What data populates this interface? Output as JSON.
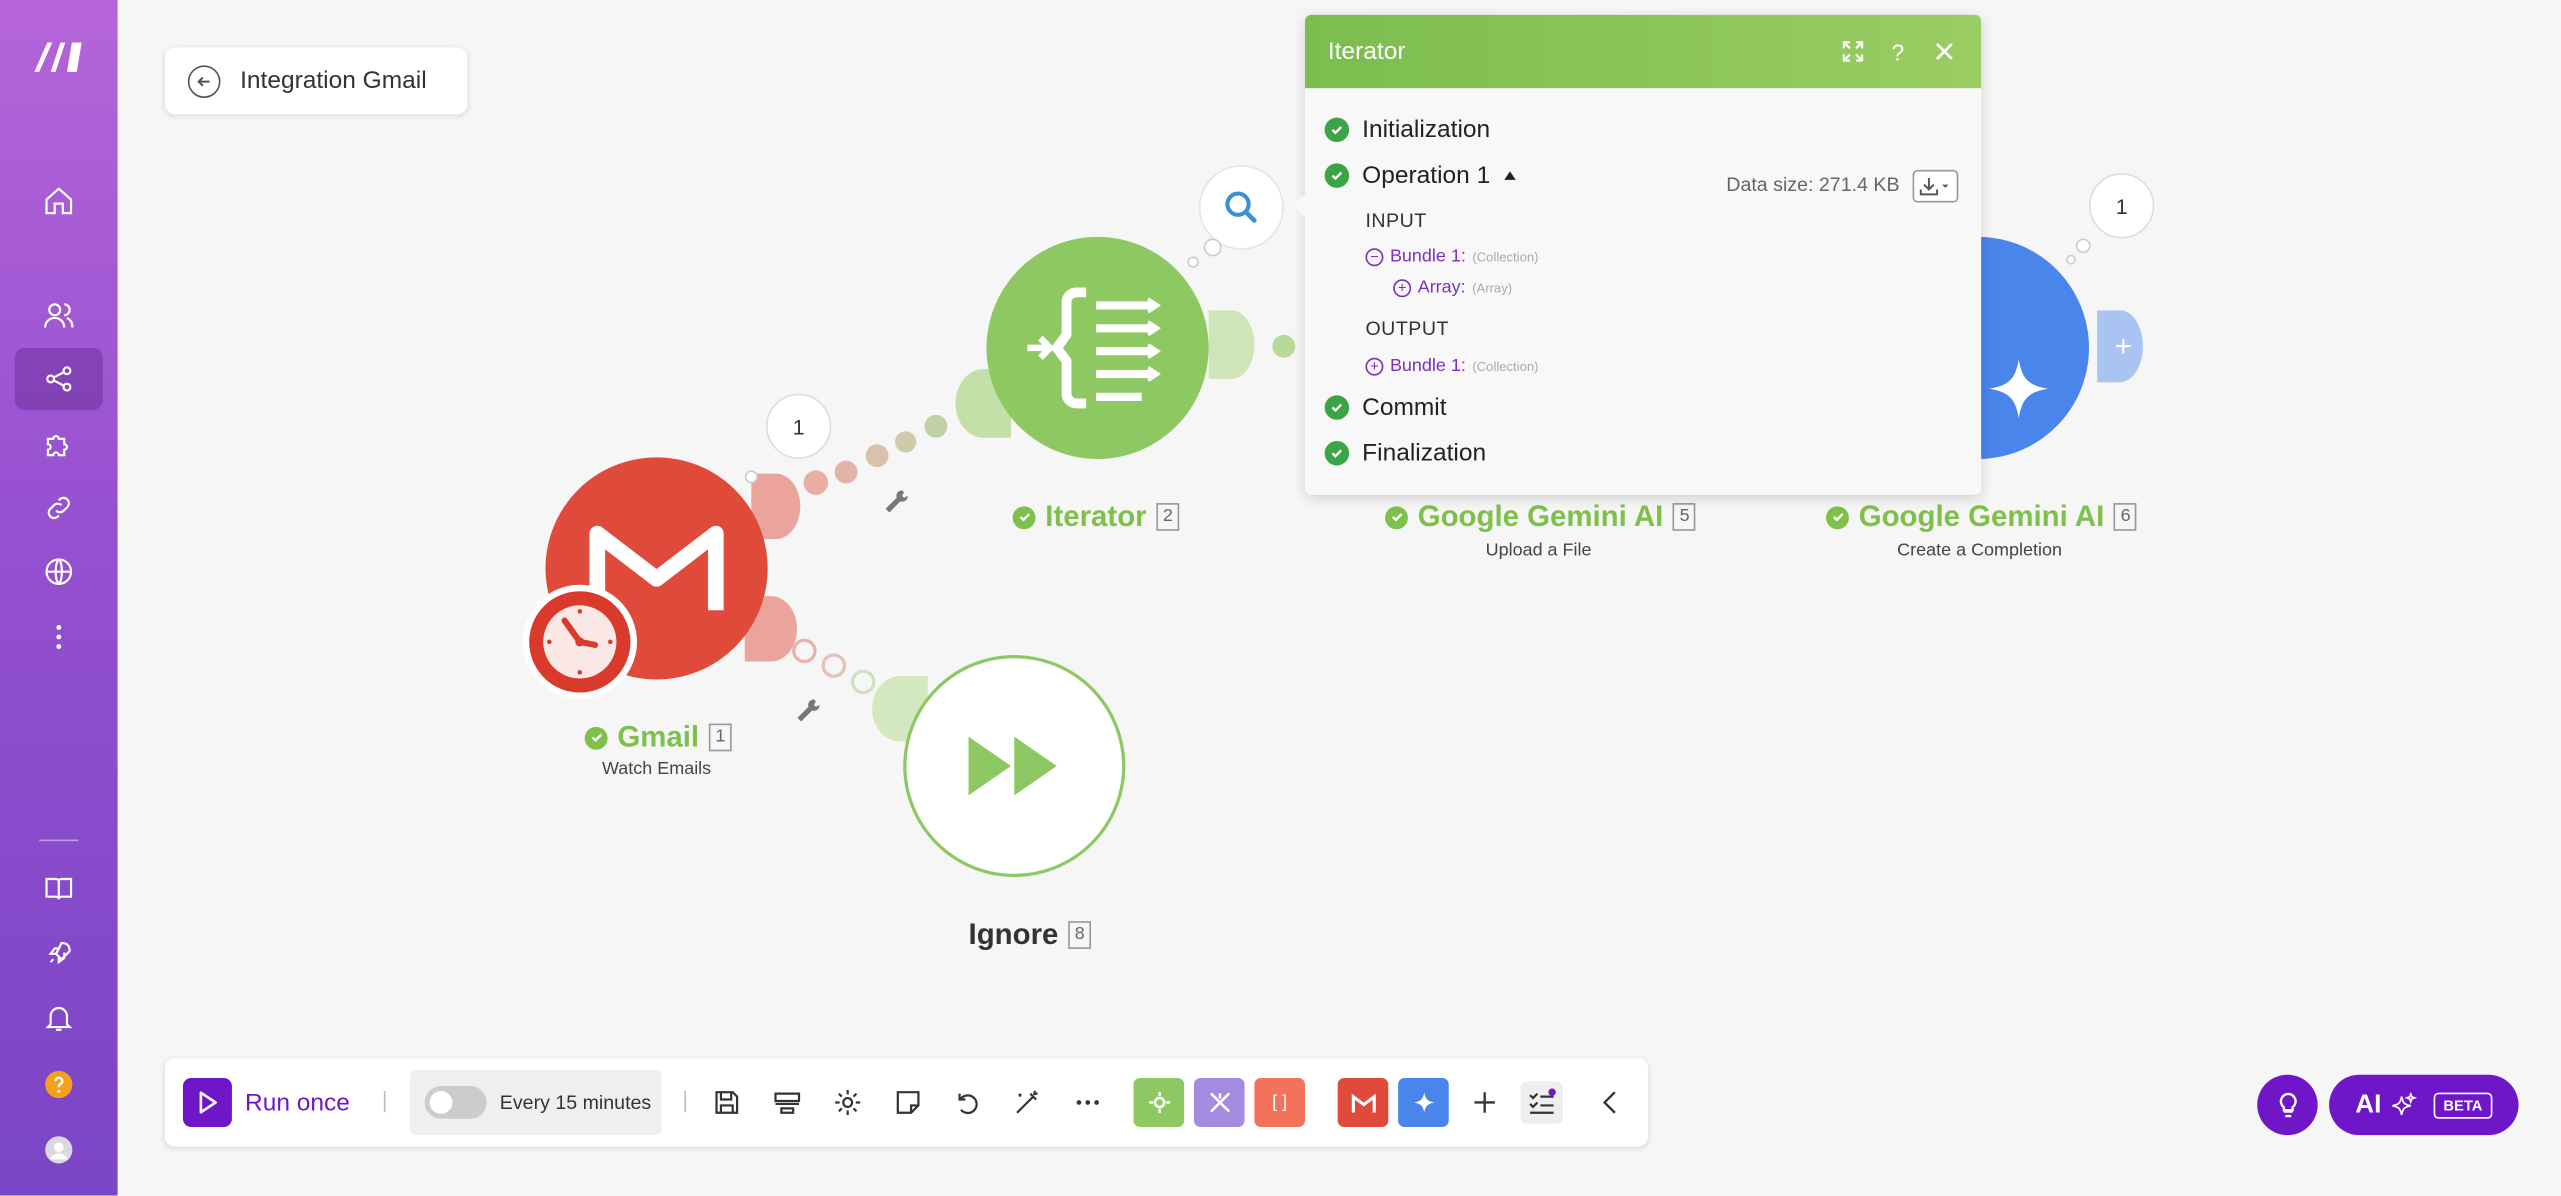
{
  "header": {
    "back_title": "Integration Gmail"
  },
  "nodes": {
    "gmail": {
      "name": "Gmail",
      "index": "1",
      "subtitle": "Watch Emails",
      "count": "1"
    },
    "iterator": {
      "name": "Iterator",
      "index": "2"
    },
    "ignore": {
      "name": "Ignore",
      "index": "8"
    },
    "gemini_upload": {
      "name": "Google Gemini AI",
      "index": "5",
      "subtitle": "Upload a File"
    },
    "gemini_complete": {
      "name": "Google Gemini AI",
      "index": "6",
      "subtitle": "Create a Completion",
      "count": "1"
    }
  },
  "panel": {
    "title": "Iterator",
    "data_size": "Data size: 271.4 KB",
    "initialization": "Initialization",
    "operation": "Operation 1",
    "input_label": "INPUT",
    "input_bundle": "Bundle 1:",
    "input_bundle_type": "(Collection)",
    "array_label": "Array:",
    "array_type": "(Array)",
    "output_label": "OUTPUT",
    "output_bundle": "Bundle 1:",
    "output_bundle_type": "(Collection)",
    "commit": "Commit",
    "finalization": "Finalization"
  },
  "toolbar": {
    "run_once": "Run once",
    "schedule": "Every 15 minutes",
    "scheduling_enabled": false
  },
  "ai": {
    "label": "AI",
    "badge": "BETA"
  },
  "colors": {
    "brand": "#6f16c9",
    "gmail": "#e04a3a",
    "iterator": "#8dc863",
    "gemini": "#4a85ec",
    "success": "#3aa447"
  }
}
